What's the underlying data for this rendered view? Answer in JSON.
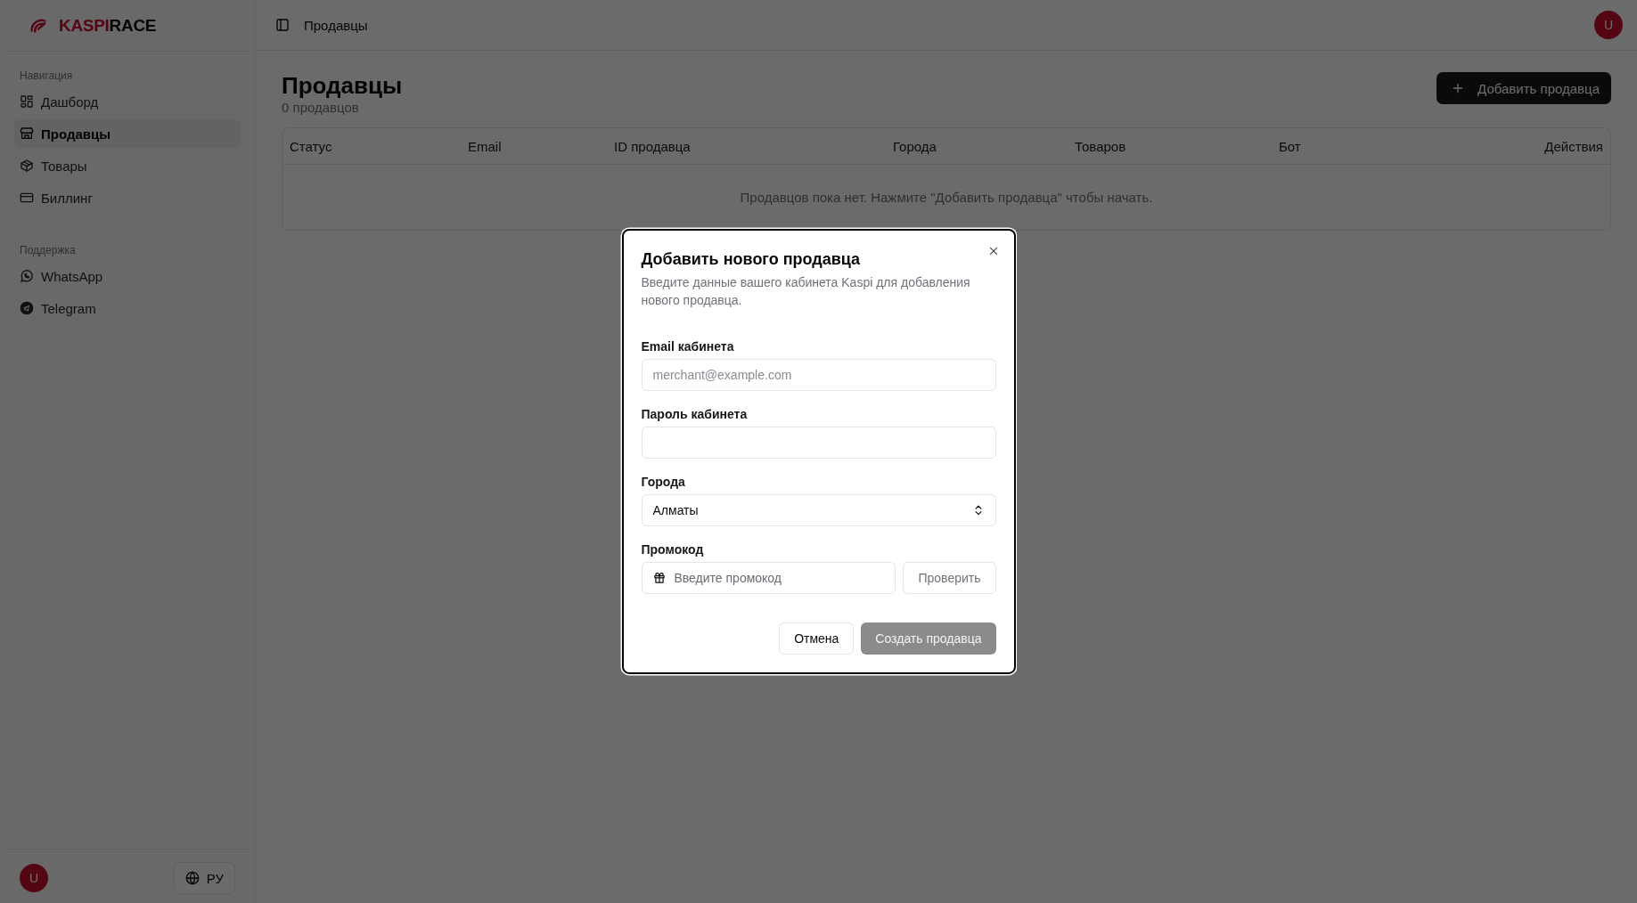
{
  "sidebar": {
    "logo": {
      "part_1": "KASPI",
      "part_2": "RACE"
    },
    "sections": [
      {
        "title": "Навигация",
        "items": [
          {
            "label": "Дашборд",
            "selected": false
          },
          {
            "label": "Продавцы",
            "selected": true
          },
          {
            "label": "Товары",
            "selected": false
          },
          {
            "label": "Биллинг",
            "selected": false
          }
        ]
      },
      {
        "title": "Поддержка",
        "items": [
          {
            "label": "WhatsApp",
            "selected": false
          },
          {
            "label": "Telegram",
            "selected": false
          }
        ]
      }
    ],
    "user_avatar": "U",
    "language_button": "РУ"
  },
  "header": {
    "breadcrumb": "Продавцы",
    "user_avatar": "U"
  },
  "page": {
    "title": "Продавцы",
    "subtitle": "0 продавцов",
    "add_button": "Добавить продавца",
    "table": {
      "columns": [
        "Статус",
        "Email",
        "ID продавца",
        "Города",
        "Товаров",
        "Бот",
        "Действия"
      ],
      "empty_message": "Продавцов пока нет. Нажмите \"Добавить продавца\" чтобы начать."
    }
  },
  "dialog": {
    "title": "Добавить нового продавца",
    "description": "Введите данные вашего кабинета Kaspi для добавления нового продавца.",
    "fields": [
      {
        "kind": "text",
        "label": "Email кабинета",
        "placeholder": "merchant@example.com"
      },
      {
        "kind": "password",
        "label": "Пароль кабинета"
      },
      {
        "kind": "select",
        "label": "Города",
        "value": "Алматы"
      },
      {
        "kind": "promo",
        "label": "Промокод",
        "placeholder": "Введите промокод",
        "button": "Проверить"
      }
    ],
    "cancel_button": "Отмена",
    "submit_button": {
      "label": "Создать продавца",
      "disabled": true
    }
  }
}
